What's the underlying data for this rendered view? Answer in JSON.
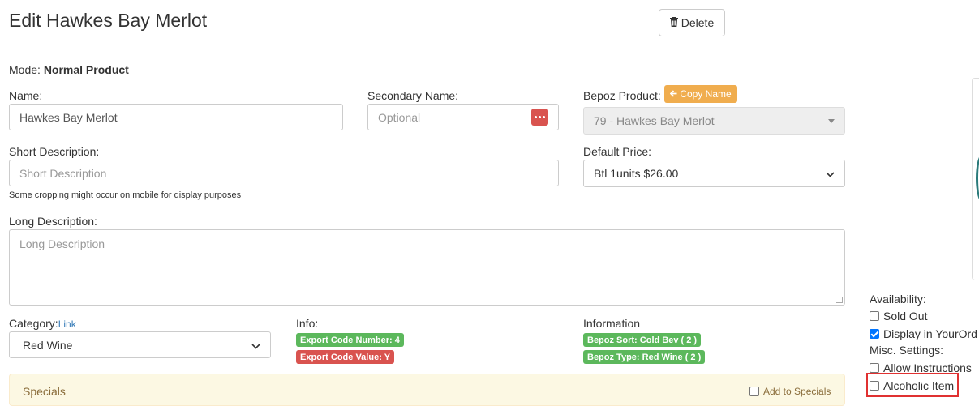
{
  "page": {
    "title": "Edit Hawkes Bay Merlot"
  },
  "header": {
    "delete_label": "Delete",
    "delete_icon": "trash-icon"
  },
  "mode": {
    "label": "Mode:",
    "value": "Normal Product"
  },
  "fields": {
    "name": {
      "label": "Name:",
      "value": "Hawkes Bay Merlot"
    },
    "secondary_name": {
      "label": "Secondary Name:",
      "placeholder": "Optional"
    },
    "bepoz_product": {
      "label": "Bepoz Product:",
      "copy_label": "Copy Name",
      "value": "79 - Hawkes Bay Merlot"
    },
    "short_description": {
      "label": "Short Description:",
      "placeholder": "Short Description",
      "help": "Some cropping might occur on mobile for display purposes"
    },
    "default_price": {
      "label": "Default Price:",
      "value": "Btl 1units $26.00"
    },
    "long_description": {
      "label": "Long Description:",
      "placeholder": "Long Description"
    },
    "category": {
      "label": "Category:",
      "link": "Link",
      "value": "Red Wine"
    }
  },
  "info": {
    "label": "Info:",
    "badges": [
      {
        "text": "Export Code Number: 4",
        "color": "#5cb85c"
      },
      {
        "text": "Export Code Value: Y",
        "color": "#d9534f"
      }
    ]
  },
  "information": {
    "label": "Information",
    "badges": [
      {
        "text": "Bepoz Sort: Cold Bev ( 2 )",
        "color": "#5cb85c"
      },
      {
        "text": "Bepoz Type: Red Wine ( 2 )",
        "color": "#5cb85c"
      }
    ]
  },
  "specials": {
    "title": "Specials",
    "add_label": "Add to Specials",
    "add_checked": false
  },
  "availability": {
    "label": "Availability:",
    "items": [
      {
        "label": "Sold Out",
        "checked": false
      },
      {
        "label": "Display in YourOrd",
        "checked": true
      }
    ]
  },
  "misc": {
    "label": "Misc. Settings:",
    "items": [
      {
        "label": "Allow Instructions",
        "checked": false
      },
      {
        "label": "Alcoholic Item",
        "checked": false
      }
    ]
  }
}
